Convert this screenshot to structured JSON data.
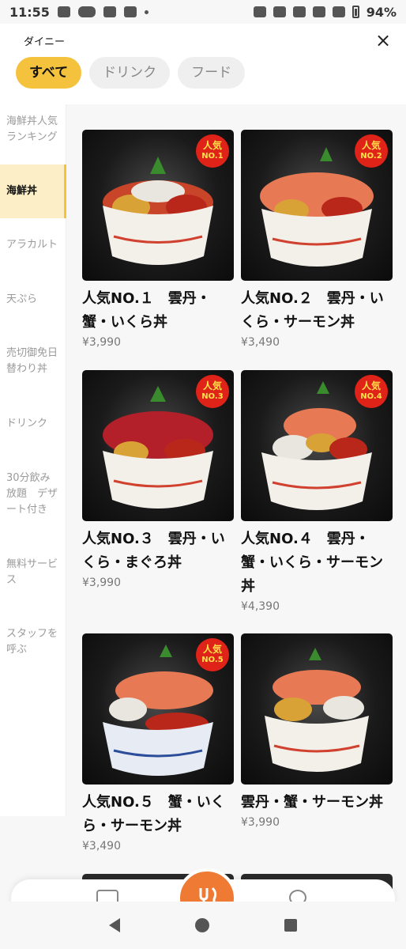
{
  "status": {
    "time": "11:55",
    "battery": "94%"
  },
  "header": {
    "shop_name": "ダイニー",
    "close_icon": "×"
  },
  "tabs": [
    {
      "label": "すべて",
      "active": true
    },
    {
      "label": "ドリンク",
      "active": false
    },
    {
      "label": "フード",
      "active": false
    }
  ],
  "sidebar": {
    "items": [
      {
        "label": "海鮮丼人気ランキング",
        "active": false
      },
      {
        "label": "海鮮丼",
        "active": true
      },
      {
        "label": "アラカルト",
        "active": false
      },
      {
        "label": "天ぷら",
        "active": false
      },
      {
        "label": "売切御免日替わり丼",
        "active": false
      },
      {
        "label": "ドリンク",
        "active": false
      },
      {
        "label": "30分飲み放題　デザート付き",
        "active": false
      },
      {
        "label": "無料サービス",
        "active": false
      },
      {
        "label": "スタッフを呼ぶ",
        "active": false
      }
    ]
  },
  "items": [
    {
      "badge_top": "人気",
      "badge_bottom": "NO.1",
      "title": "人気NO.１　雲丹・蟹・いくら丼",
      "price": "¥3,990"
    },
    {
      "badge_top": "人気",
      "badge_bottom": "NO.2",
      "title": "人気NO.２　雲丹・いくら・サーモン丼",
      "price": "¥3,490"
    },
    {
      "badge_top": "人気",
      "badge_bottom": "NO.3",
      "title": "人気NO.３　雲丹・いくら・まぐろ丼",
      "price": "¥3,990"
    },
    {
      "badge_top": "人気",
      "badge_bottom": "NO.4",
      "title": "人気NO.４　雲丹・蟹・いくら・サーモン丼",
      "price": "¥4,390"
    },
    {
      "badge_top": "人気",
      "badge_bottom": "NO.5",
      "title": "人気NO.５　蟹・いくら・サーモン丼",
      "price": "¥3,490"
    },
    {
      "badge_top": "",
      "badge_bottom": "",
      "title": "雲丹・蟹・サーモン丼",
      "price": "¥3,990"
    }
  ],
  "colors": {
    "accent": "#f4c23d",
    "badge": "#e02318",
    "fab": "#ef7a33"
  }
}
